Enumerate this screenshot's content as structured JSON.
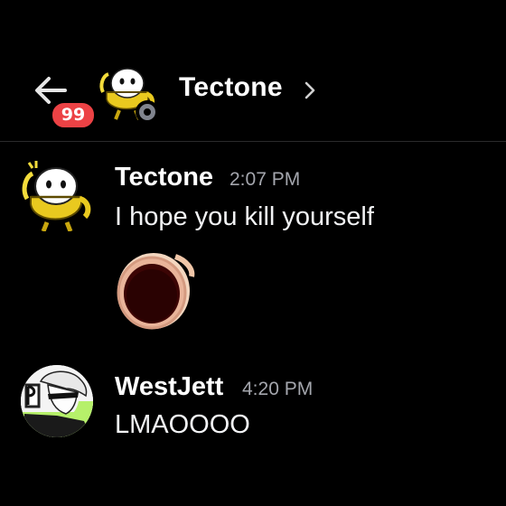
{
  "header": {
    "title": "Tectone",
    "notification_count": "99"
  },
  "messages": [
    {
      "author": "Tectone",
      "time": "2:07 PM",
      "content": "I hope you kill yourself",
      "attachment": "custom-emoji"
    },
    {
      "author": "WestJett",
      "time": "4:20 PM",
      "content": "LMAOOOO"
    }
  ],
  "colors": {
    "background": "#000000",
    "badge": "#ec4245",
    "timestamp": "#a4a6ad",
    "status_offline": "#80848e"
  },
  "icons": [
    "back-arrow-icon",
    "chevron-right-icon",
    "offline-status-icon"
  ]
}
